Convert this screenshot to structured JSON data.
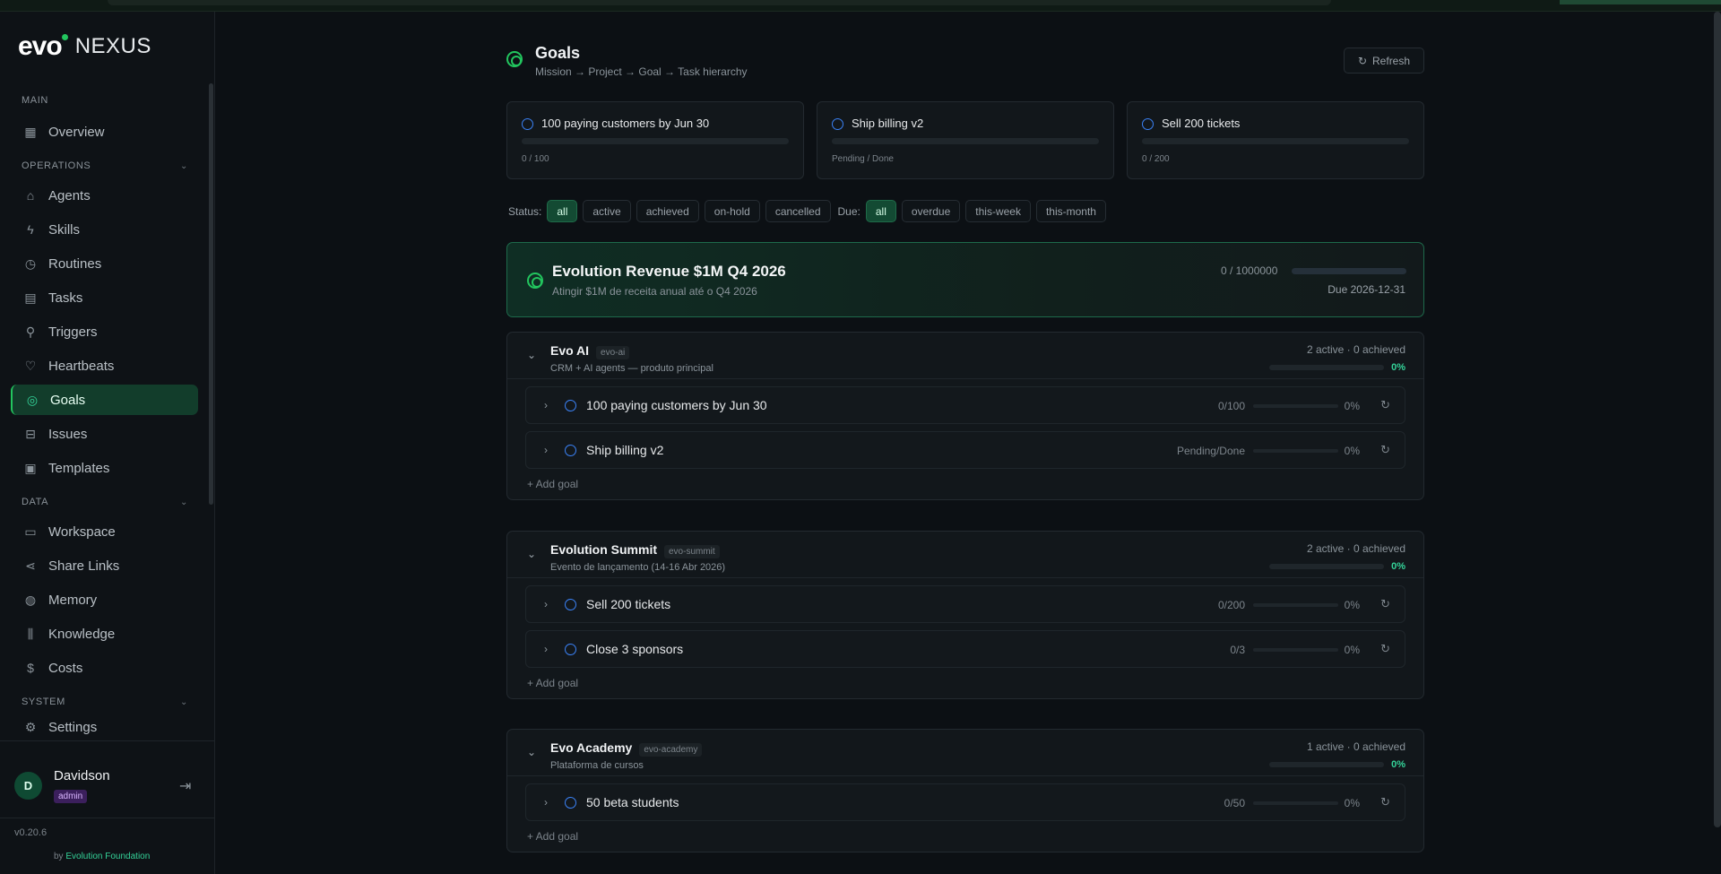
{
  "brand": {
    "evo": "evo",
    "nexus": "NEXUS"
  },
  "sidebar": {
    "sections": {
      "main": "MAIN",
      "operations": "OPERATIONS",
      "data": "DATA",
      "system": "SYSTEM"
    },
    "items": [
      {
        "label": "Overview",
        "icon": "grid-icon"
      },
      {
        "label": "Agents",
        "icon": "bot-icon"
      },
      {
        "label": "Skills",
        "icon": "zap-icon"
      },
      {
        "label": "Routines",
        "icon": "clock-icon"
      },
      {
        "label": "Tasks",
        "icon": "calendar-icon"
      },
      {
        "label": "Triggers",
        "icon": "webhook-icon"
      },
      {
        "label": "Heartbeats",
        "icon": "heart-icon"
      },
      {
        "label": "Goals",
        "icon": "target-icon"
      },
      {
        "label": "Issues",
        "icon": "ticket-icon"
      },
      {
        "label": "Templates",
        "icon": "layout-icon"
      },
      {
        "label": "Workspace",
        "icon": "folder-icon"
      },
      {
        "label": "Share Links",
        "icon": "share-icon"
      },
      {
        "label": "Memory",
        "icon": "brain-icon"
      },
      {
        "label": "Knowledge",
        "icon": "library-icon"
      },
      {
        "label": "Costs",
        "icon": "dollar-icon"
      },
      {
        "label": "Settings",
        "icon": "gear-icon"
      }
    ]
  },
  "user": {
    "initial": "D",
    "name": "Davidson",
    "role": "admin"
  },
  "footer": {
    "version": "v0.20.6",
    "by": "by",
    "org": "Evolution Foundation"
  },
  "header": {
    "title": "Goals",
    "subtitle": "Mission → Project → Goal → Task hierarchy",
    "refresh": "Refresh"
  },
  "cards": [
    {
      "title": "100 paying customers by Jun 30",
      "value": "0 / 100",
      "progress": 0
    },
    {
      "title": "Ship billing v2",
      "value": "Pending / Done",
      "progress": 0
    },
    {
      "title": "Sell 200 tickets",
      "value": "0 / 200",
      "progress": 0
    }
  ],
  "filters": {
    "status_label": "Status:",
    "status": [
      "all",
      "active",
      "achieved",
      "on-hold",
      "cancelled"
    ],
    "due_label": "Due:",
    "due": [
      "all",
      "overdue",
      "this-week",
      "this-month"
    ]
  },
  "mission": {
    "title": "Evolution Revenue $1M Q4 2026",
    "subtitle": "Atingir $1M de receita anual até o Q4 2026",
    "value": "0 / 1000000",
    "due": "Due 2026-12-31",
    "progress": 0
  },
  "projects": [
    {
      "name": "Evo AI",
      "slug": "evo-ai",
      "desc": "CRM + AI agents — produto principal",
      "stat": "2 active · 0 achieved",
      "pct": "0%",
      "goals": [
        {
          "name": "100 paying customers by Jun 30",
          "value": "0/100",
          "pct": "0%"
        },
        {
          "name": "Ship billing v2",
          "value": "Pending/Done",
          "pct": "0%"
        }
      ],
      "add": "+ Add goal"
    },
    {
      "name": "Evolution Summit",
      "slug": "evo-summit",
      "desc": "Evento de lançamento (14-16 Abr 2026)",
      "stat": "2 active · 0 achieved",
      "pct": "0%",
      "goals": [
        {
          "name": "Sell 200 tickets",
          "value": "0/200",
          "pct": "0%"
        },
        {
          "name": "Close 3 sponsors",
          "value": "0/3",
          "pct": "0%"
        }
      ],
      "add": "+ Add goal"
    },
    {
      "name": "Evo Academy",
      "slug": "evo-academy",
      "desc": "Plataforma de cursos",
      "stat": "1 active · 0 achieved",
      "pct": "0%",
      "goals": [
        {
          "name": "50 beta students",
          "value": "0/50",
          "pct": "0%"
        }
      ],
      "add": "+ Add goal"
    }
  ]
}
